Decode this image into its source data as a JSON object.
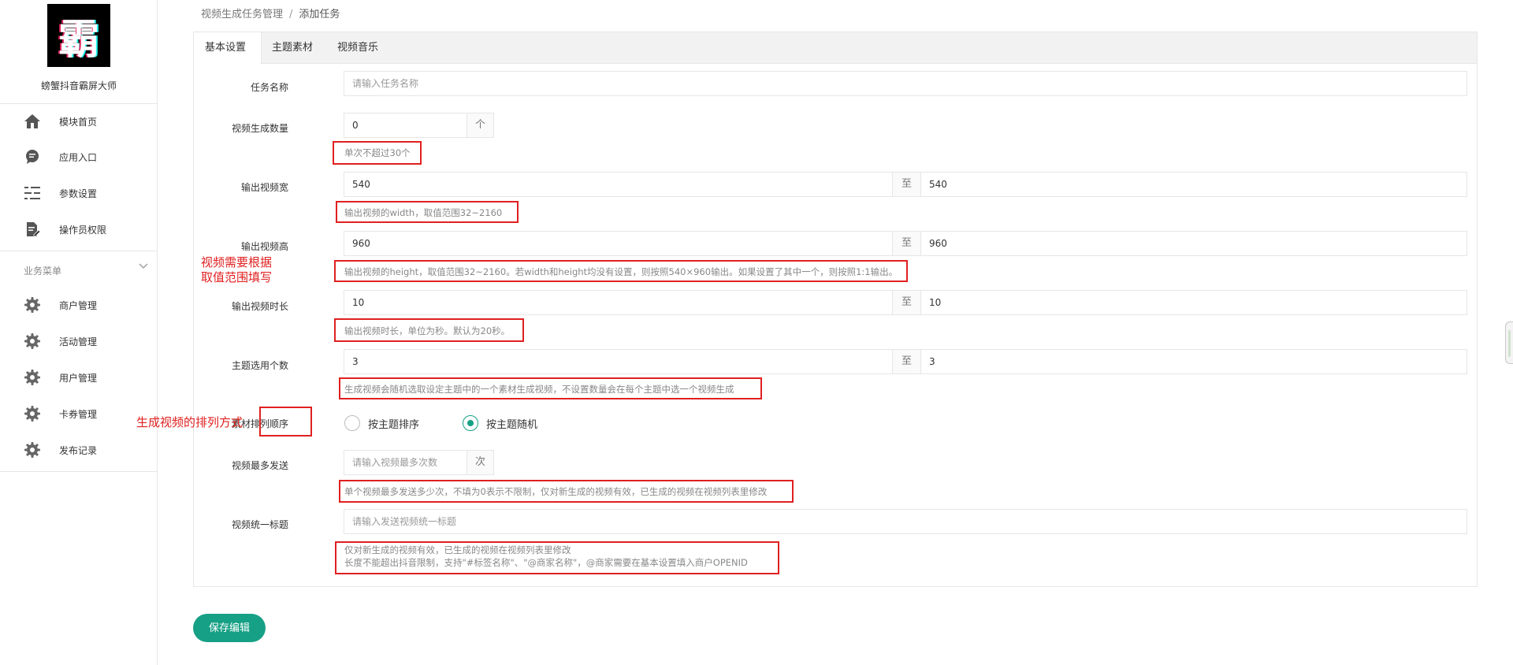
{
  "sidebar": {
    "logo_char": "霸",
    "app_name": "螃蟹抖音霸屏大师",
    "top_items": [
      {
        "label": "模块首页",
        "icon": "home-icon"
      },
      {
        "label": "应用入口",
        "icon": "chat-bubble-icon"
      },
      {
        "label": "参数设置",
        "icon": "list-settings-icon"
      },
      {
        "label": "操作员权限",
        "icon": "edit-document-icon"
      }
    ],
    "section_title": "业务菜单",
    "section_items": [
      {
        "label": "商户管理",
        "icon": "gear-icon"
      },
      {
        "label": "活动管理",
        "icon": "gear-icon"
      },
      {
        "label": "用户管理",
        "icon": "gear-icon"
      },
      {
        "label": "卡券管理",
        "icon": "gear-icon"
      },
      {
        "label": "发布记录",
        "icon": "gear-icon"
      }
    ]
  },
  "breadcrumb": {
    "parent": "视频生成任务管理",
    "separator": "/",
    "current": "添加任务"
  },
  "tabs": [
    {
      "label": "基本设置",
      "active": true
    },
    {
      "label": "主题素材",
      "active": false
    },
    {
      "label": "视频音乐",
      "active": false
    }
  ],
  "form": {
    "task_name": {
      "label": "任务名称",
      "placeholder": "请输入任务名称"
    },
    "count": {
      "label": "视频生成数量",
      "value": "0",
      "unit": "个",
      "hint": "单次不超过30个"
    },
    "width": {
      "label": "输出视频宽",
      "min": "540",
      "sep": "至",
      "max": "540",
      "hint": "输出视频的width，取值范围32~2160"
    },
    "height": {
      "label": "输出视频高",
      "min": "960",
      "sep": "至",
      "max": "960",
      "hint": "输出视频的height，取值范围32~2160。若width和height均没有设置，则按照540×960输出。如果设置了其中一个，则按照1:1输出。"
    },
    "duration": {
      "label": "输出视频时长",
      "min": "10",
      "sep": "至",
      "max": "10",
      "hint": "输出视频时长，单位为秒。默认为20秒。"
    },
    "theme_count": {
      "label": "主题选用个数",
      "min": "3",
      "sep": "至",
      "max": "3",
      "hint": "生成视频会随机选取设定主题中的一个素材生成视频，不设置数量会在每个主题中选一个视频生成"
    },
    "order": {
      "label": "素材排列顺序",
      "options": [
        {
          "label": "按主题排序",
          "checked": false
        },
        {
          "label": "按主题随机",
          "checked": true
        }
      ]
    },
    "max_send": {
      "label": "视频最多发送",
      "placeholder": "请输入视频最多次数",
      "unit": "次",
      "hint": "单个视频最多发送多少次，不填为0表示不限制，仅对新生成的视频有效，已生成的视频在视频列表里修改"
    },
    "title": {
      "label": "视频统一标题",
      "placeholder": "请输入发送视频统一标题",
      "hint_line1": "仅对新生成的视频有效，已生成的视频在视频列表里修改",
      "hint_line2": "长度不能超出抖音限制，支持\"#标签名称\"、\"@商家名称\"，@商家需要在基本设置填入商户OPENID"
    }
  },
  "annotations": {
    "range_note_line1": "视频需要根据",
    "range_note_line2": "取值范围填写",
    "order_note": "生成视频的排列方式"
  },
  "save_button": "保存编辑",
  "colors": {
    "accent": "#16a085",
    "annotation_red": "#e02020"
  }
}
